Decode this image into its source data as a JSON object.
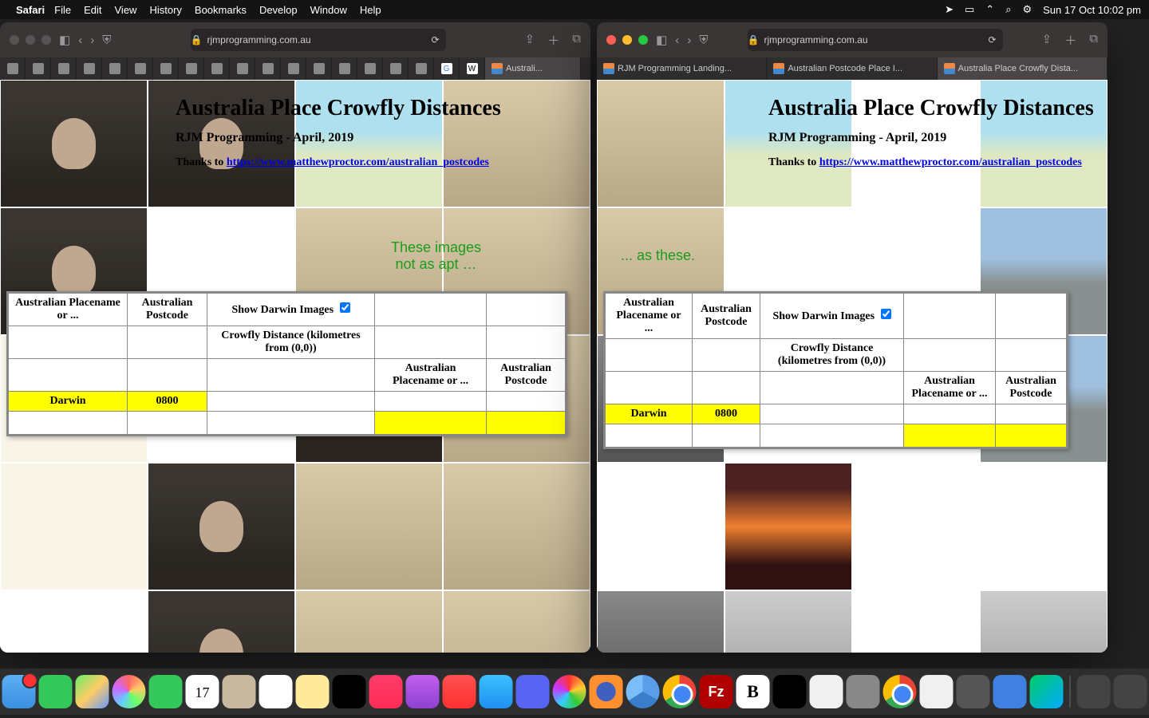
{
  "menubar": {
    "app": "Safari",
    "items": [
      "File",
      "Edit",
      "View",
      "History",
      "Bookmarks",
      "Develop",
      "Window",
      "Help"
    ],
    "clock": "Sun 17 Oct  10:02 pm"
  },
  "windows": {
    "left": {
      "address": "rjmprogramming.com.au",
      "tab_label": "Australi..."
    },
    "right": {
      "address": "rjmprogramming.com.au",
      "tabs": [
        "RJM Programming Landing...",
        "Australian Postcode Place I...",
        "Australia Place Crowfly Dista..."
      ]
    }
  },
  "page": {
    "title": "Australia Place Crowfly Distances",
    "subtitle": "RJM Programming - April, 2019",
    "thanks_prefix": "Thanks to ",
    "thanks_link": "https://www.matthewproctor.com/australian_postcodes",
    "caption_left_line1": "These images",
    "caption_left_line2": "not as apt …",
    "caption_right": "... as these.",
    "table": {
      "h_placename": "Australian Placename or ...",
      "h_postcode": "Australian Postcode",
      "h_showimg": "Show Darwin Images",
      "h_crowfly": "Crowfly Distance (kilometres from (0,0))",
      "h_placename2": "Australian Placename or ...",
      "h_postcode2": "Australian Postcode",
      "val_place": "Darwin",
      "val_postcode": "0800"
    }
  },
  "dock": {
    "cal_day": "17"
  }
}
